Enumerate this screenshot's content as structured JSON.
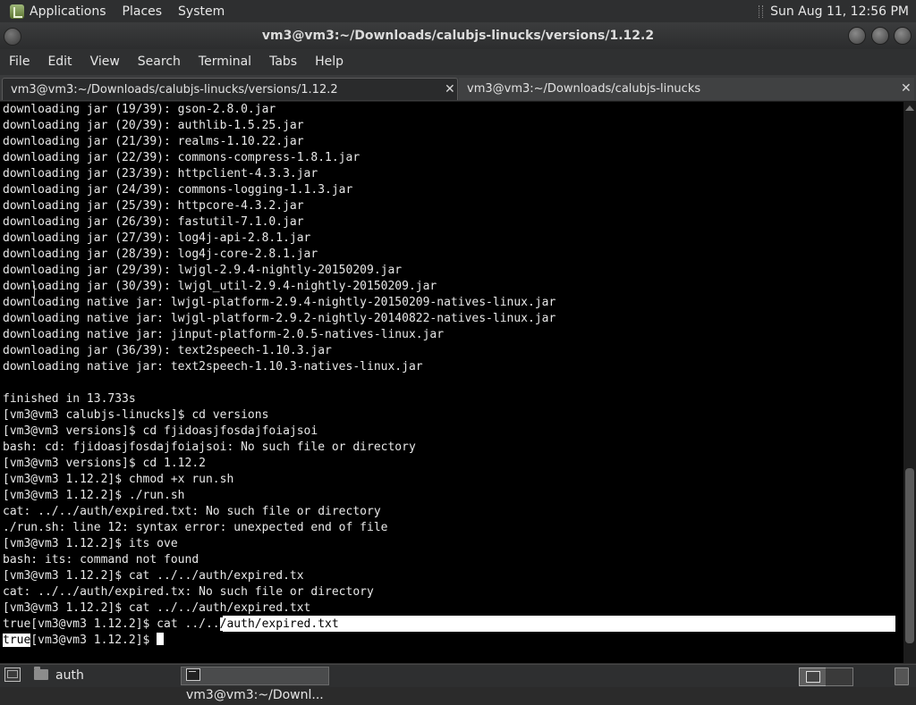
{
  "top_panel": {
    "applications": "Applications",
    "places": "Places",
    "system": "System",
    "clock": "Sun Aug 11, 12:56 PM"
  },
  "window": {
    "title": "vm3@vm3:~/Downloads/calubjs-linucks/versions/1.12.2"
  },
  "menu": {
    "file": "File",
    "edit": "Edit",
    "view": "View",
    "search": "Search",
    "terminal": "Terminal",
    "tabs": "Tabs",
    "help": "Help"
  },
  "tabs": [
    {
      "label": "vm3@vm3:~/Downloads/calubjs-linucks/versions/1.12.2",
      "close": "✕"
    },
    {
      "label": "vm3@vm3:~/Downloads/calubjs-linucks",
      "close": "✕"
    }
  ],
  "terminal": {
    "lines": [
      "downloading jar (19/39): gson-2.8.0.jar",
      "downloading jar (20/39): authlib-1.5.25.jar",
      "downloading jar (21/39): realms-1.10.22.jar",
      "downloading jar (22/39): commons-compress-1.8.1.jar",
      "downloading jar (23/39): httpclient-4.3.3.jar",
      "downloading jar (24/39): commons-logging-1.1.3.jar",
      "downloading jar (25/39): httpcore-4.3.2.jar",
      "downloading jar (26/39): fastutil-7.1.0.jar",
      "downloading jar (27/39): log4j-api-2.8.1.jar",
      "downloading jar (28/39): log4j-core-2.8.1.jar",
      "downloading jar (29/39): lwjgl-2.9.4-nightly-20150209.jar",
      "downloading jar (30/39): lwjgl_util-2.9.4-nightly-20150209.jar",
      "downloading native jar: lwjgl-platform-2.9.4-nightly-20150209-natives-linux.jar",
      "downloading native jar: lwjgl-platform-2.9.2-nightly-20140822-natives-linux.jar",
      "downloading native jar: jinput-platform-2.0.5-natives-linux.jar",
      "downloading jar (36/39): text2speech-1.10.3.jar",
      "downloading native jar: text2speech-1.10.3-natives-linux.jar",
      "",
      "finished in 13.733s",
      "[vm3@vm3 calubjs-linucks]$ cd versions",
      "[vm3@vm3 versions]$ cd fjidoasjfosdajfoiajsoi",
      "bash: cd: fjidoasjfosdajfoiajsoi: No such file or directory",
      "[vm3@vm3 versions]$ cd 1.12.2",
      "[vm3@vm3 1.12.2]$ chmod +x run.sh",
      "[vm3@vm3 1.12.2]$ ./run.sh",
      "cat: ../../auth/expired.txt: No such file or directory",
      "./run.sh: line 12: syntax error: unexpected end of file",
      "[vm3@vm3 1.12.2]$ its ove",
      "bash: its: command not found",
      "[vm3@vm3 1.12.2]$ cat ../../auth/expired.tx",
      "cat: ../../auth/expired.tx: No such file or directory",
      "[vm3@vm3 1.12.2]$ cat ../../auth/expired.txt"
    ],
    "selected_line_prefix": "true[vm3@vm3 1.12.2]$ cat ../..",
    "selected_line_highlight": "/auth/expired.txt",
    "last_line_highlight": "true",
    "last_line_prompt": "[vm3@vm3 1.12.2]$ "
  },
  "bottom_panel": {
    "folder_label": "auth",
    "task_label": "vm3@vm3:~/Downl..."
  },
  "icons": {
    "app_menu": "foot-logo-icon",
    "desktop": "show-desktop-icon",
    "folder": "folder-icon",
    "terminal": "terminal-icon",
    "workspace": "workspace-switcher-icon",
    "trash": "trash-icon"
  }
}
